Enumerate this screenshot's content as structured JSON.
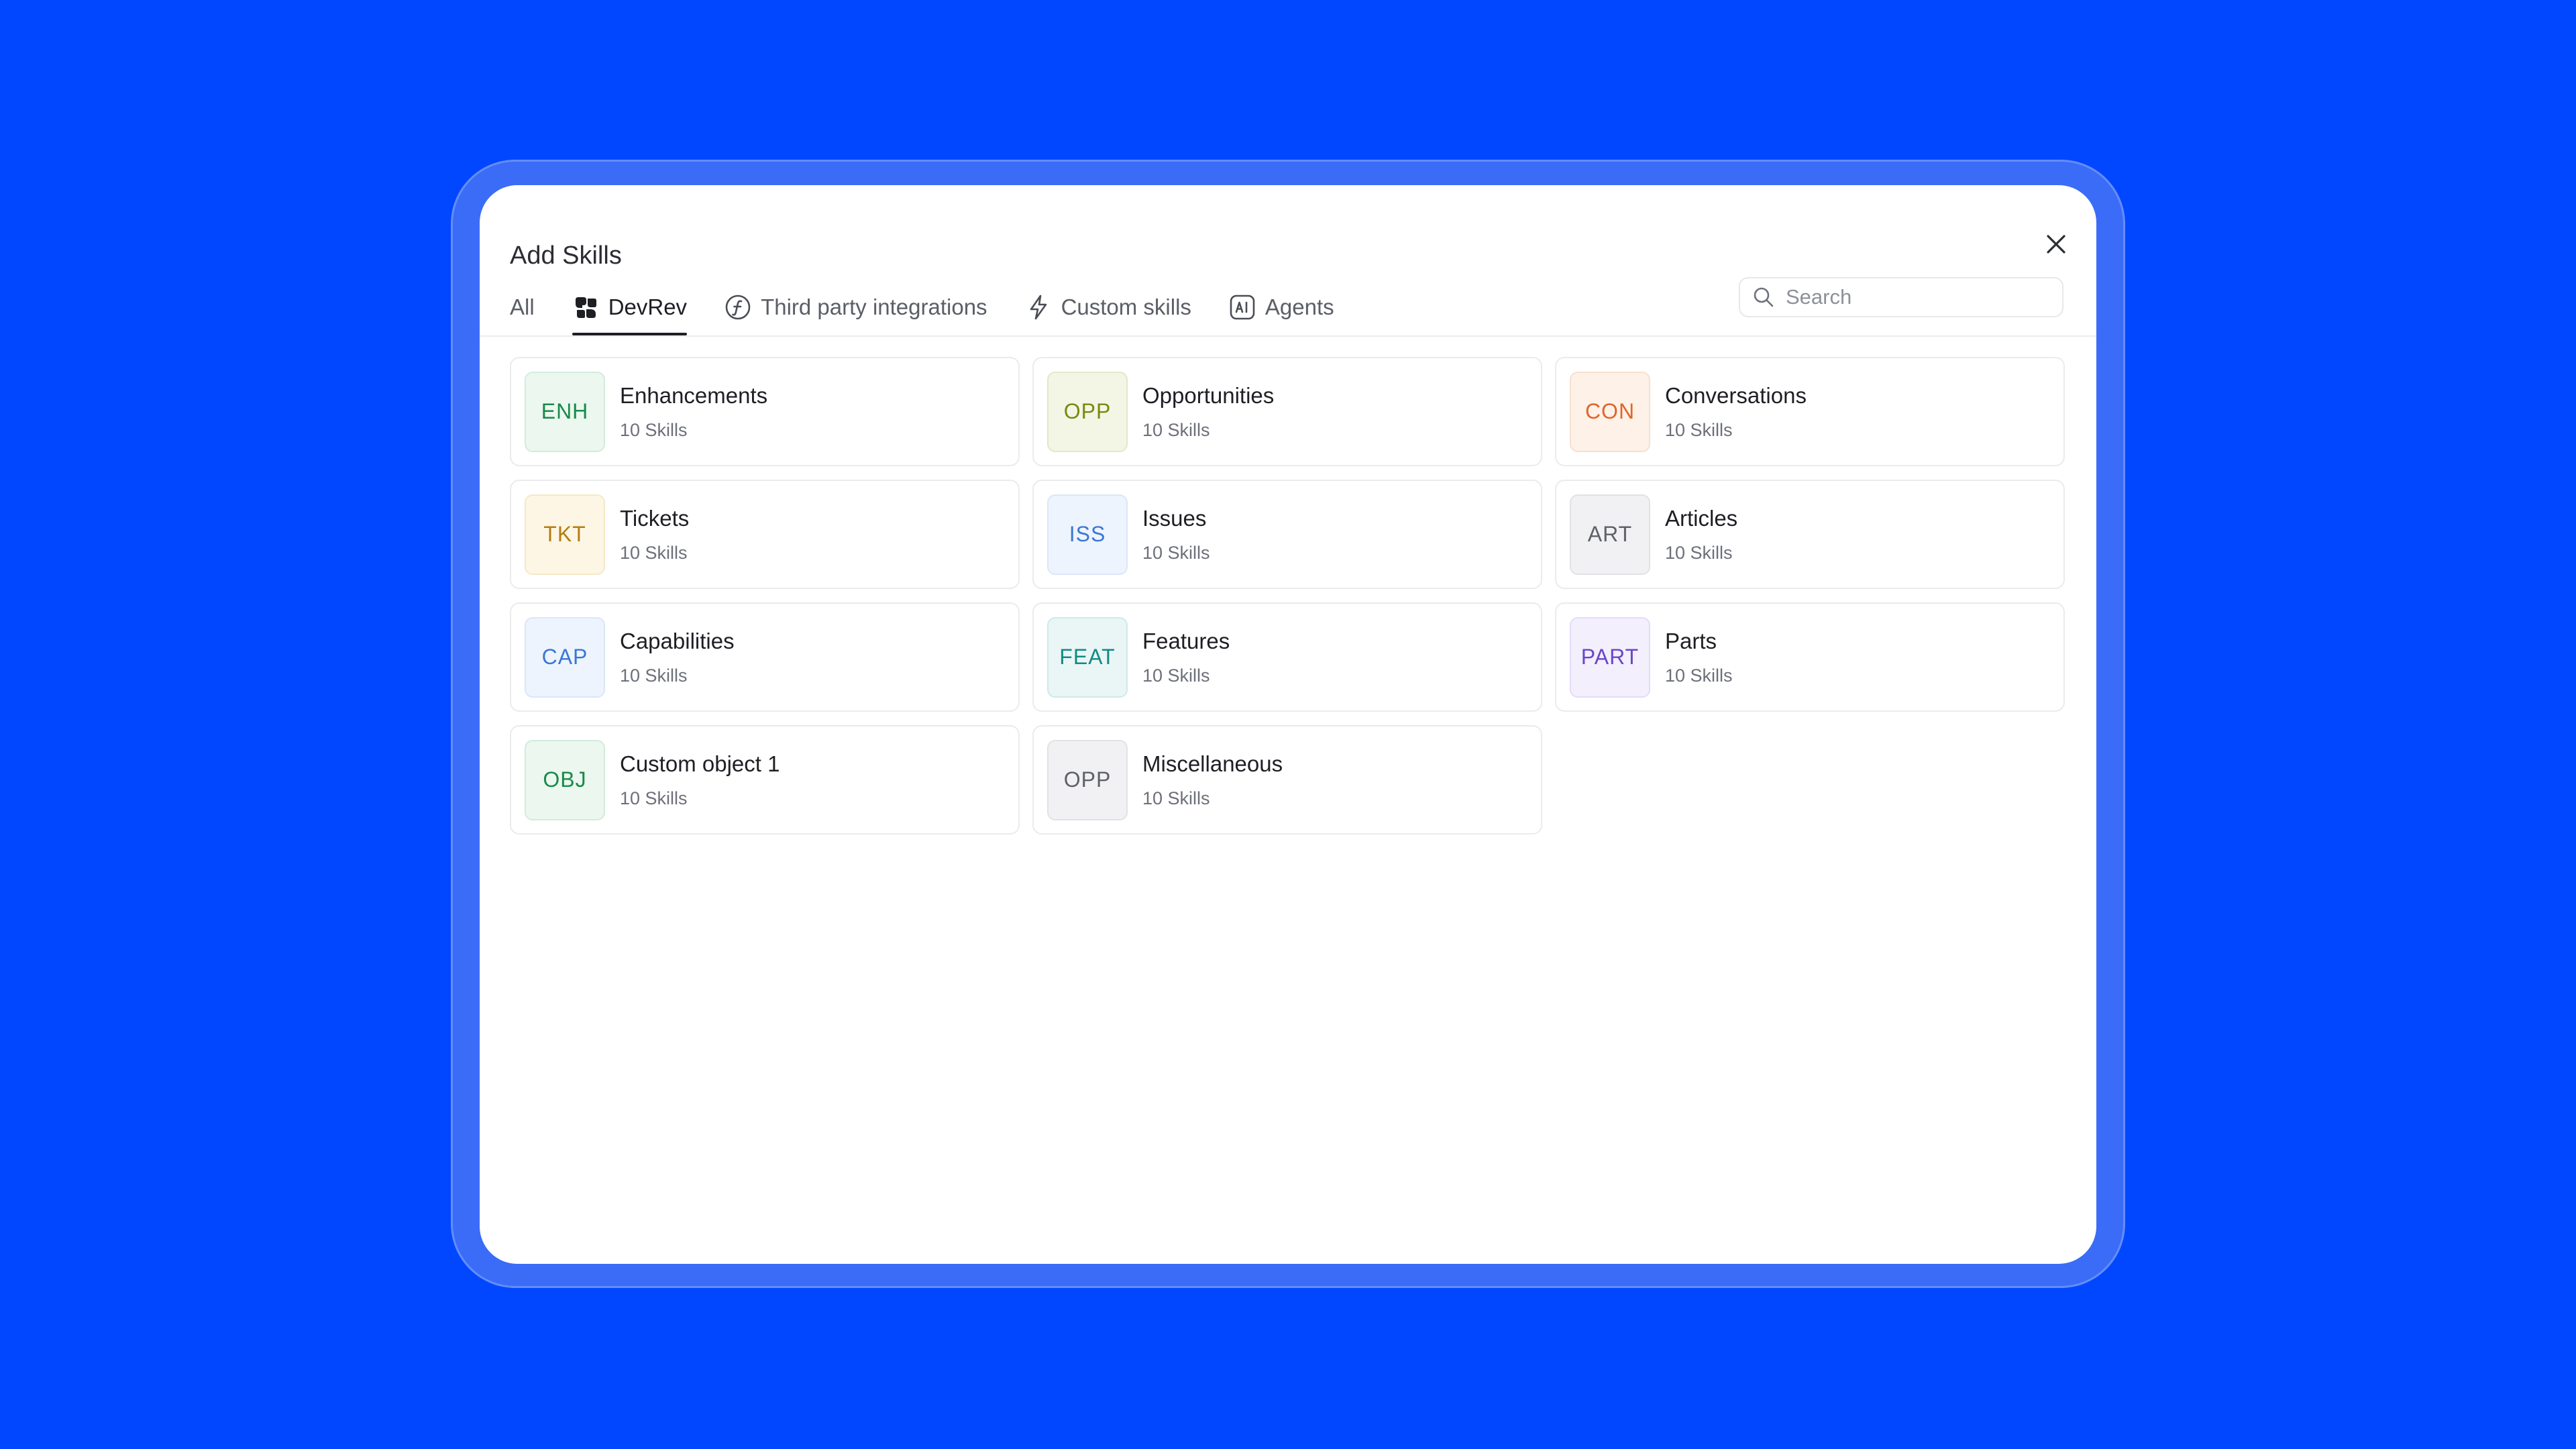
{
  "dialog": {
    "title": "Add Skills"
  },
  "tabs": [
    {
      "label": "All",
      "icon": "none",
      "active": false
    },
    {
      "label": "DevRev",
      "icon": "devrev-logo-icon",
      "active": true
    },
    {
      "label": "Third party integrations",
      "icon": "function-circle-icon",
      "active": false
    },
    {
      "label": "Custom skills",
      "icon": "lightning-icon",
      "active": false
    },
    {
      "label": "Agents",
      "icon": "ai-box-icon",
      "active": false
    }
  ],
  "search": {
    "placeholder": "Search"
  },
  "cards": [
    {
      "code": "ENH",
      "name": "Enhancements",
      "count": "10 Skills",
      "fg": "#1a8a4a",
      "bg": "#ebf7ef",
      "border": "#d3ecdc"
    },
    {
      "code": "OPP",
      "name": "Opportunities",
      "count": "10 Skills",
      "fg": "#7a8a0e",
      "bg": "#f3f6e4",
      "border": "#e2e8c6"
    },
    {
      "code": "CON",
      "name": "Conversations",
      "count": "10 Skills",
      "fg": "#e0662a",
      "bg": "#fdf1e8",
      "border": "#f8e0cf"
    },
    {
      "code": "TKT",
      "name": "Tickets",
      "count": "10 Skills",
      "fg": "#b57c10",
      "bg": "#fdf6e5",
      "border": "#f6e8c7"
    },
    {
      "code": "ISS",
      "name": "Issues",
      "count": "10 Skills",
      "fg": "#3a78d6",
      "bg": "#eef4fd",
      "border": "#dbe6f8"
    },
    {
      "code": "ART",
      "name": "Articles",
      "count": "10 Skills",
      "fg": "#5f6169",
      "bg": "#f1f1f3",
      "border": "#e2e2e6"
    },
    {
      "code": "CAP",
      "name": "Capabilities",
      "count": "10 Skills",
      "fg": "#3a78d6",
      "bg": "#eef4fd",
      "border": "#dbe6f8"
    },
    {
      "code": "FEAT",
      "name": "Features",
      "count": "10 Skills",
      "fg": "#128a86",
      "bg": "#e9f6f5",
      "border": "#cfe9e7"
    },
    {
      "code": "PART",
      "name": "Parts",
      "count": "10 Skills",
      "fg": "#6a46c8",
      "bg": "#f3effd",
      "border": "#e3dbf8"
    },
    {
      "code": "OBJ",
      "name": "Custom object 1",
      "count": "10 Skills",
      "fg": "#1a8a4a",
      "bg": "#ebf7ef",
      "border": "#d3ecdc"
    },
    {
      "code": "OPP",
      "name": "Miscellaneous",
      "count": "10 Skills",
      "fg": "#5f6169",
      "bg": "#f1f1f3",
      "border": "#e2e2e6"
    }
  ],
  "colors": {
    "background": "#0047ff",
    "frame": "#3a6cf8",
    "dialog": "#ffffff",
    "text_primary": "#1e1f24",
    "text_secondary": "#6d7079"
  }
}
